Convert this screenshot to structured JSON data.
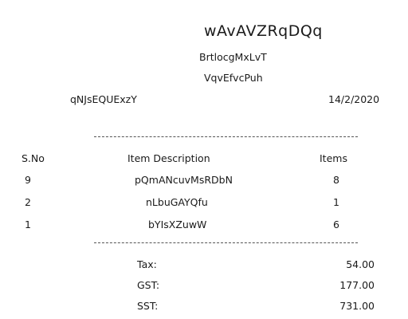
{
  "header": {
    "store_name": "wAvAVZRqDQq",
    "line1": "BrtlocgMxLvT",
    "line2": "VqvEfvcPuh",
    "cashier": "qNJsEQUExzY",
    "date": "14/2/2020"
  },
  "table": {
    "columns": [
      "S.No",
      "Item Description",
      "Items"
    ],
    "rows": [
      {
        "sno": "9",
        "description": "pQmANcuvMsRDbN",
        "items": "8"
      },
      {
        "sno": "2",
        "description": "nLbuGAYQfu",
        "items": "1"
      },
      {
        "sno": "1",
        "description": "bYIsXZuwW",
        "items": "6"
      }
    ]
  },
  "totals": [
    {
      "label": "Tax:",
      "value": "54.00"
    },
    {
      "label": "GST:",
      "value": "177.00"
    },
    {
      "label": "SST:",
      "value": "731.00"
    }
  ]
}
